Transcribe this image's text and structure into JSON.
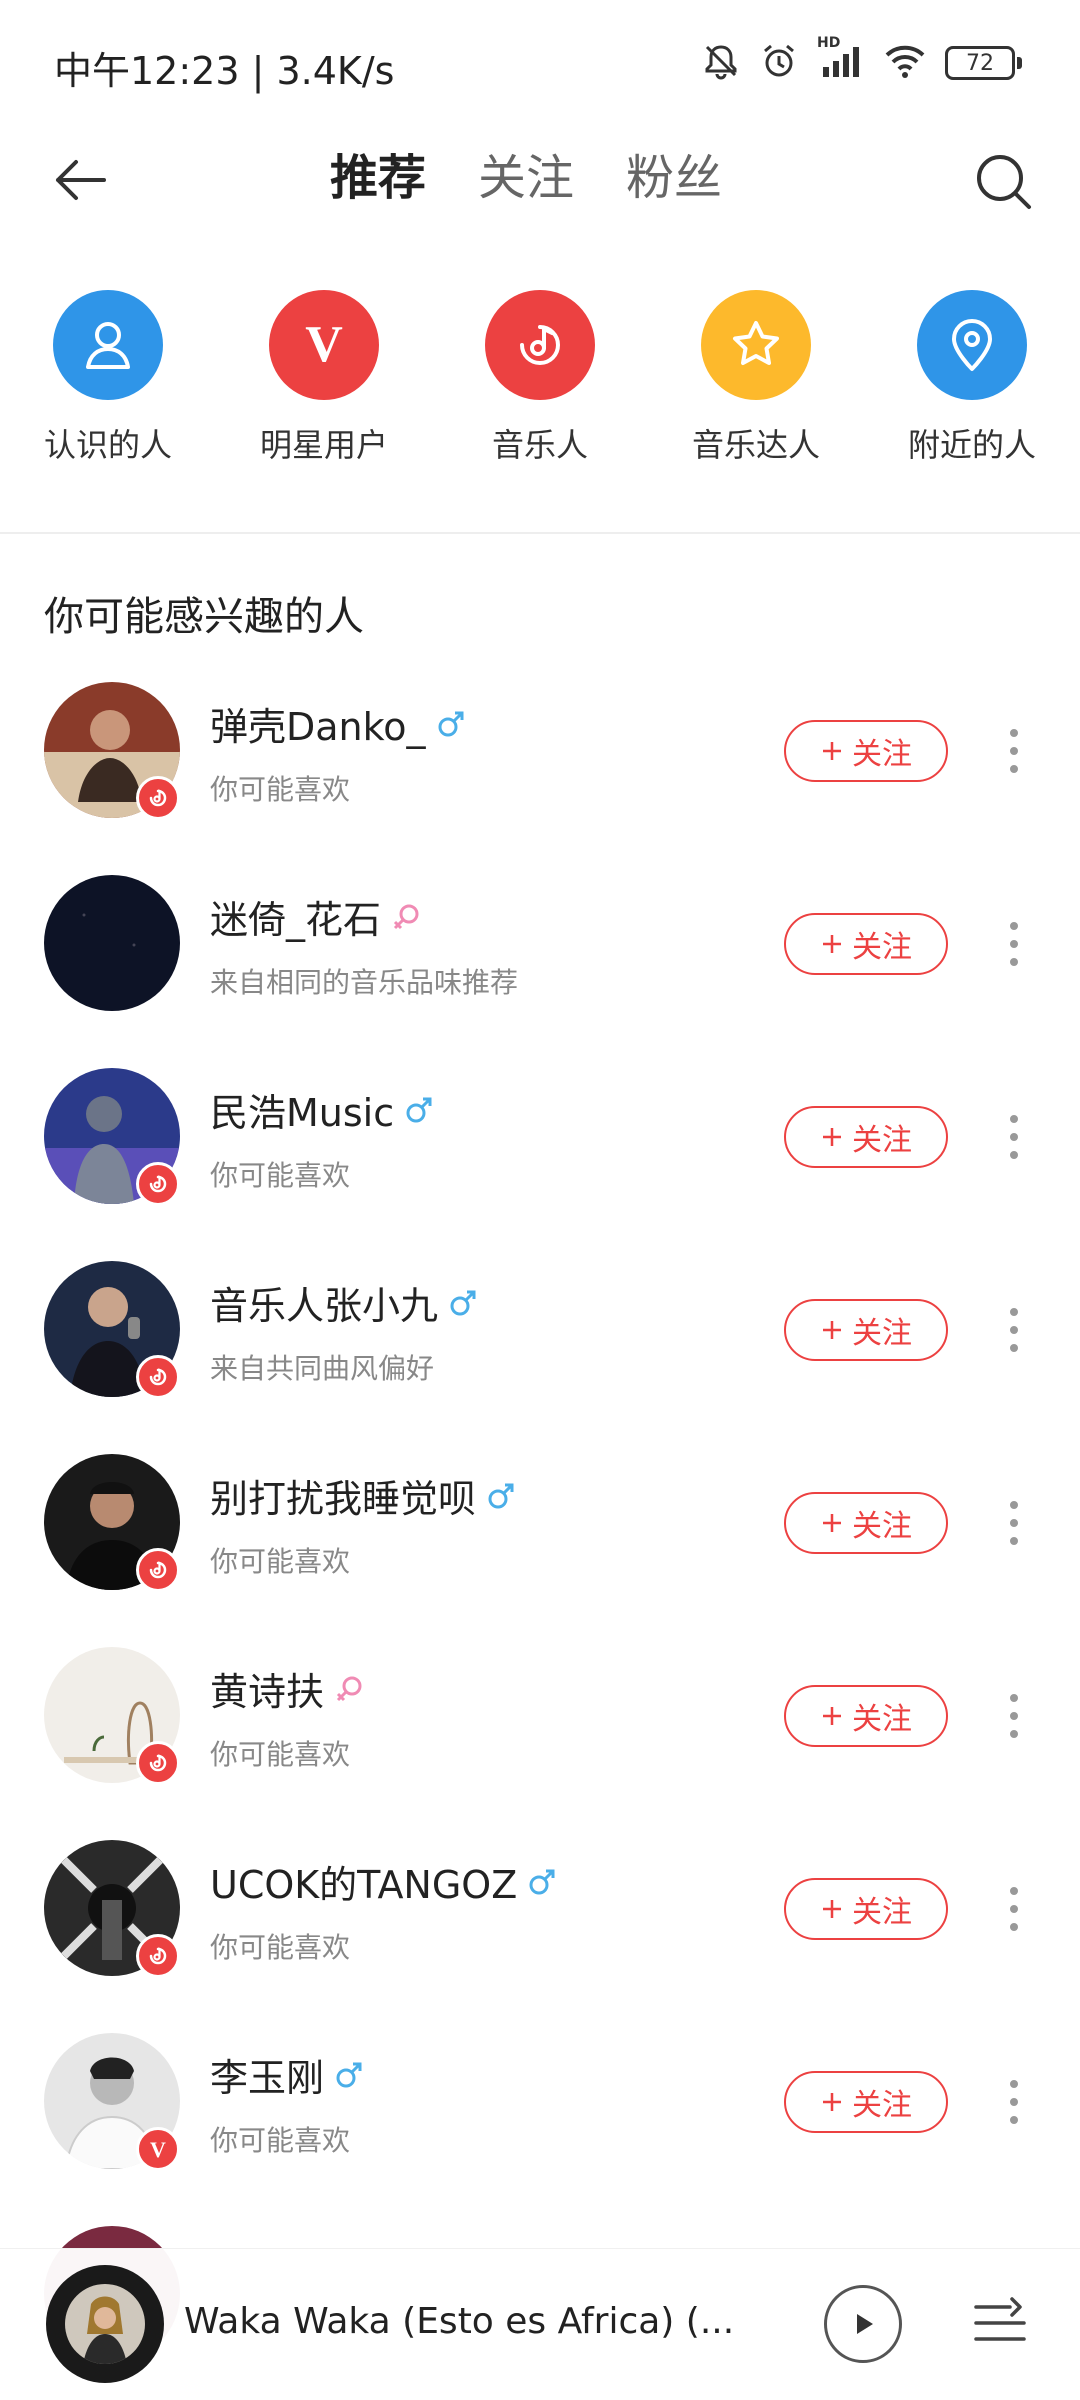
{
  "status_bar": {
    "time_speed": "中午12:23 | 3.4K/s",
    "hd_label": "HD",
    "battery": "72"
  },
  "header": {
    "tabs": [
      {
        "label": "推荐",
        "active": true
      },
      {
        "label": "关注",
        "active": false
      },
      {
        "label": "粉丝",
        "active": false
      }
    ]
  },
  "categories": [
    {
      "label": "认识的人",
      "icon": "person-icon",
      "color": "#2f95e8"
    },
    {
      "label": "明星用户",
      "icon": "v-badge-icon",
      "color": "#ec4141"
    },
    {
      "label": "音乐人",
      "icon": "music-note-icon",
      "color": "#ec4141"
    },
    {
      "label": "音乐达人",
      "icon": "star-icon",
      "color": "#fdb92c"
    },
    {
      "label": "附近的人",
      "icon": "location-pin-icon",
      "color": "#2f95e8"
    }
  ],
  "section_title": "你可能感兴趣的人",
  "users": [
    {
      "name": "弹壳Danko_",
      "gender": "male",
      "sub": "你可能喜欢",
      "badge": "musician",
      "follow": "关注"
    },
    {
      "name": "迷倚_花石",
      "gender": "female",
      "sub": "来自相同的音乐品味推荐",
      "badge": "none",
      "follow": "关注"
    },
    {
      "name": "民浩Music",
      "gender": "male",
      "sub": "你可能喜欢",
      "badge": "musician",
      "follow": "关注"
    },
    {
      "name": "音乐人张小九",
      "gender": "male",
      "sub": "来自共同曲风偏好",
      "badge": "musician",
      "follow": "关注"
    },
    {
      "name": "别打扰我睡觉呗",
      "gender": "male",
      "sub": "你可能喜欢",
      "badge": "musician",
      "follow": "关注"
    },
    {
      "name": "黄诗扶",
      "gender": "female",
      "sub": "你可能喜欢",
      "badge": "musician",
      "follow": "关注"
    },
    {
      "name": "UCOK的TANGOZ",
      "gender": "male",
      "sub": "你可能喜欢",
      "badge": "musician",
      "follow": "关注"
    },
    {
      "name": "李玉刚",
      "gender": "male",
      "sub": "你可能喜欢",
      "badge": "verified",
      "follow": "关注"
    }
  ],
  "player": {
    "title": "Waka Waka (Esto es Africa) (..."
  },
  "colors": {
    "accent": "#ec4141",
    "male": "#4aaee8",
    "female": "#f08bb4"
  }
}
